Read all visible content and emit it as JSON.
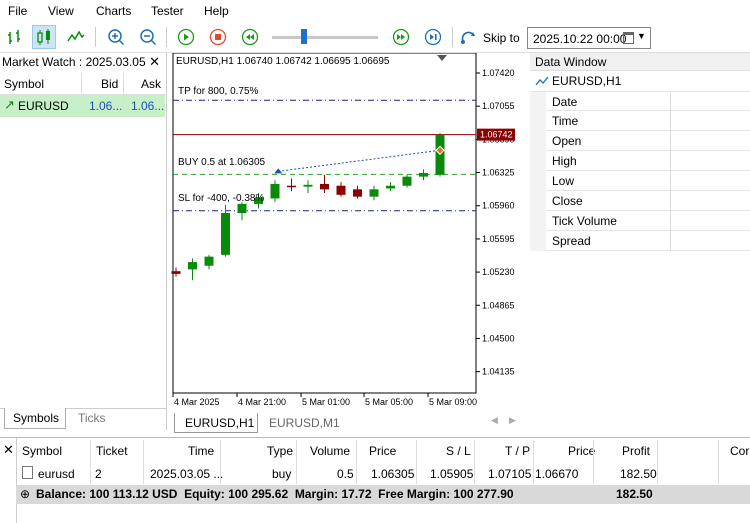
{
  "menu": [
    "File",
    "View",
    "Charts",
    "Tester",
    "Help"
  ],
  "toolbar": {
    "skip_label": "Skip to",
    "date_value": "2025.10.22 00:00"
  },
  "market_watch": {
    "title": "Market Watch : 2025.03.05",
    "close": "✕",
    "headers": [
      "Symbol",
      "Bid",
      "Ask"
    ],
    "row": {
      "symbol": "EURUSD",
      "bid": "1.06...",
      "ask": "1.06..."
    },
    "tabs": [
      "Symbols",
      "Ticks"
    ]
  },
  "chart": {
    "header": "EURUSD,H1  1.06740 1.06742 1.06695 1.06695",
    "tp_label": "TP for 800, 0.75%",
    "buy_label": "BUY 0.5 at 1.06305",
    "sl_label": "SL for -400, -0.38%",
    "current_price": "1.06742",
    "tabs": [
      "EURUSD,H1",
      "EURUSD,M1"
    ]
  },
  "chart_data": {
    "type": "candlestick",
    "price_ticks": [
      "1.07420",
      "1.07055",
      "1.06690",
      "1.06325",
      "1.05960",
      "1.05595",
      "1.05230",
      "1.04865",
      "1.04500",
      "1.04135"
    ],
    "time_ticks": [
      "4 Mar 2025",
      "4 Mar 21:00",
      "5 Mar 01:00",
      "5 Mar 05:00",
      "5 Mar 09:00"
    ],
    "ylim": [
      1.039,
      1.0764
    ],
    "candles": [
      {
        "o": 1.0524,
        "h": 1.0528,
        "l": 1.0518,
        "c": 1.0521
      },
      {
        "o": 1.0526,
        "h": 1.0538,
        "l": 1.0514,
        "c": 1.0534
      },
      {
        "o": 1.053,
        "h": 1.0542,
        "l": 1.0526,
        "c": 1.054
      },
      {
        "o": 1.0542,
        "h": 1.0597,
        "l": 1.054,
        "c": 1.0588
      },
      {
        "o": 1.0588,
        "h": 1.06,
        "l": 1.058,
        "c": 1.0598
      },
      {
        "o": 1.0598,
        "h": 1.061,
        "l": 1.0593,
        "c": 1.0605
      },
      {
        "o": 1.0604,
        "h": 1.0624,
        "l": 1.06,
        "c": 1.062
      },
      {
        "o": 1.0618,
        "h": 1.0626,
        "l": 1.0612,
        "c": 1.0617
      },
      {
        "o": 1.0617,
        "h": 1.0624,
        "l": 1.061,
        "c": 1.0619
      },
      {
        "o": 1.062,
        "h": 1.063,
        "l": 1.061,
        "c": 1.0614
      },
      {
        "o": 1.0618,
        "h": 1.0622,
        "l": 1.0606,
        "c": 1.0608
      },
      {
        "o": 1.0614,
        "h": 1.0618,
        "l": 1.0604,
        "c": 1.0606
      },
      {
        "o": 1.0606,
        "h": 1.0618,
        "l": 1.0602,
        "c": 1.0614
      },
      {
        "o": 1.0615,
        "h": 1.0622,
        "l": 1.0612,
        "c": 1.0618
      },
      {
        "o": 1.0618,
        "h": 1.063,
        "l": 1.0616,
        "c": 1.0628
      },
      {
        "o": 1.0628,
        "h": 1.0636,
        "l": 1.0624,
        "c": 1.0632
      },
      {
        "o": 1.063,
        "h": 1.0676,
        "l": 1.0628,
        "c": 1.0674
      }
    ],
    "tp": 1.0712,
    "entry": 1.06305,
    "sl": 1.05905,
    "current": 1.06742
  },
  "data_window": {
    "title": "Data Window",
    "symbol": "EURUSD,H1",
    "rows": [
      "Date",
      "Time",
      "Open",
      "High",
      "Low",
      "Close",
      "Tick Volume",
      "Spread"
    ]
  },
  "trade": {
    "headers": [
      "Symbol",
      "Ticket",
      "Time",
      "Type",
      "Volume",
      "Price",
      "S / L",
      "T / P",
      "Price",
      "Profit",
      "Cor"
    ],
    "row": [
      "eurusd",
      "2",
      "2025.03.05 ...",
      "buy",
      "0.5",
      "1.06305",
      "1.05905",
      "1.07105",
      "1.06670",
      "182.50"
    ],
    "balance": "Balance: 100 113.12 USD  Equity: 100 295.62  Margin: 17.72  Free Margin: 100 277.90",
    "balance_profit": "182.50"
  },
  "colors": {
    "bull": "#0a8a0a",
    "bear": "#8b0000",
    "selected_row": "#c8f0c8"
  }
}
